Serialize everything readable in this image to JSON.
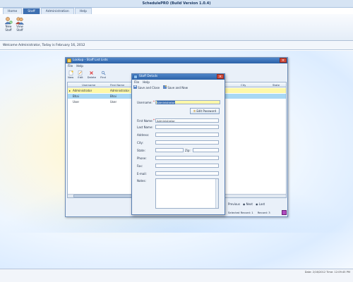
{
  "app": {
    "title": "SchedulePRO (Build Version 1.0.4)",
    "tabs": [
      "Home",
      "Staff",
      "Administration",
      "Help"
    ],
    "active_tab": "Staff"
  },
  "ribbon": {
    "new_staff": "New Staff",
    "view_staff": "View Staff"
  },
  "welcome": "Welcome Administrator, Today is February 16, 2012",
  "status": "Date: 2/16/2012   Time: 12:09:45 PM",
  "list_window": {
    "title": "Lookup - Staff List Lists",
    "menu": [
      "File",
      "Help"
    ],
    "toolbar": [
      "New",
      "Edit",
      "Delete",
      "Find"
    ],
    "columns": [
      "Username",
      "First Name",
      "City",
      "State"
    ],
    "rows": [
      {
        "username": "Administrator",
        "first_name": "Administrator"
      },
      {
        "username": "Bhai",
        "first_name": "Bhai"
      },
      {
        "username": "User",
        "first_name": "User"
      }
    ],
    "nav": [
      "Previous",
      "Next",
      "Last"
    ],
    "selected_record": "Selected Record: 1",
    "record_count": "Record: 3"
  },
  "detail_window": {
    "title": "Staff Details",
    "menu": [
      "File",
      "Help"
    ],
    "save_close": "Save and Close",
    "save_new": "Save and New",
    "edit_password": "Edit Password",
    "labels": {
      "username": "Username:",
      "first_name": "First Name:",
      "last_name": "Last Name:",
      "address": "Address:",
      "city": "City:",
      "state": "State:",
      "zip": "Zip:",
      "phone": "Phone:",
      "fax": "Fax:",
      "email": "E-mail:",
      "notes": "Notes:"
    },
    "values": {
      "username": "Administrator",
      "first_name": "Administrator"
    }
  },
  "colors": {
    "accent": "#3d6fb1",
    "row_selected": "#fff8a8",
    "row_alt": "#a8d8f4"
  }
}
